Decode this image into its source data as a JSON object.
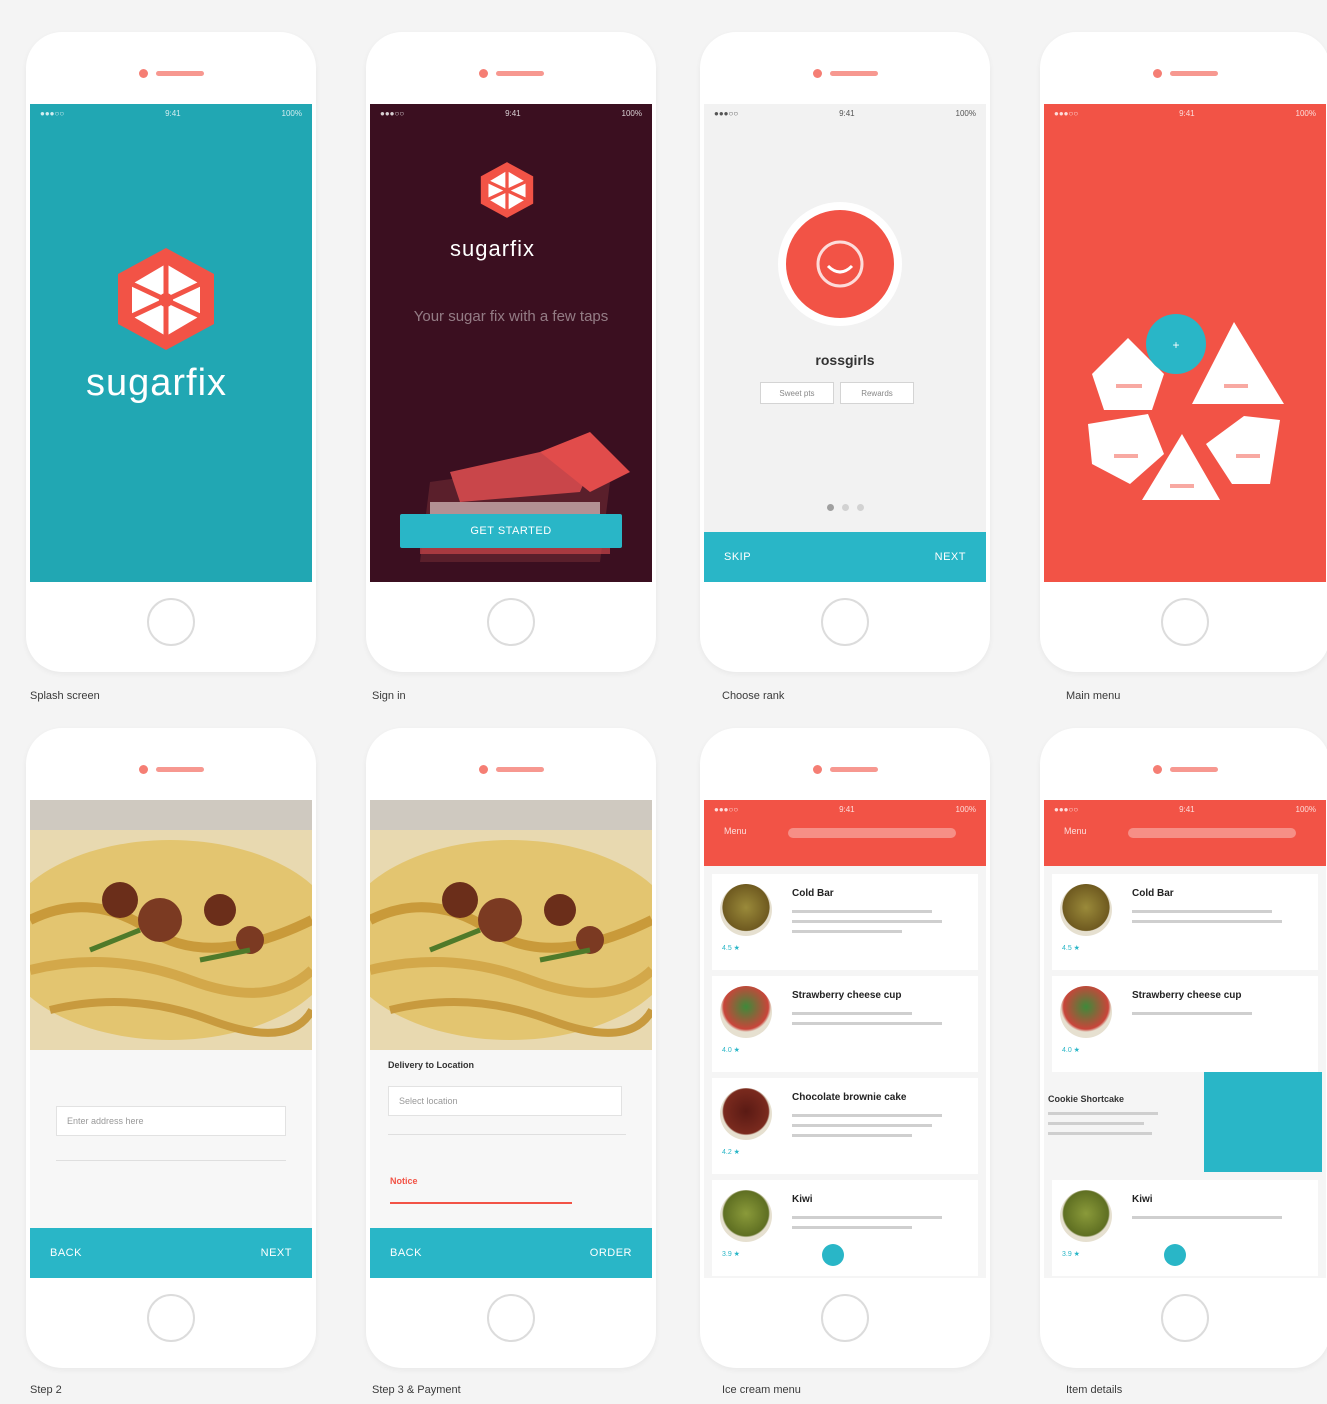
{
  "colors": {
    "background": "#f4f4f4",
    "teal": "#21a7b3",
    "accent_blue": "#29b6c7",
    "red": "#f25346",
    "maroon": "#3b0f20",
    "white": "#ffffff"
  },
  "screens": [
    {
      "label": "Splash screen",
      "wordmark": "sugarfix"
    },
    {
      "label": "Sign in",
      "wordmark": "sugarfix",
      "tagline": "Your sugar fix with a few taps",
      "cta": "GET STARTED"
    },
    {
      "label": "Choose rank",
      "user_name": "rossgirls",
      "stat_a": "Sweet pts",
      "stat_b": "Rewards",
      "cta_left": "SKIP",
      "cta_right": "NEXT"
    },
    {
      "label": "Main menu"
    },
    {
      "label": "Step 2",
      "field": "Enter address here",
      "cta_left": "BACK",
      "cta_right": "NEXT"
    },
    {
      "label": "Step 3 & Payment",
      "field_title": "Delivery to Location",
      "field_value": "Select location",
      "warning": "Notice",
      "cta_left": "BACK",
      "cta_right": "ORDER"
    },
    {
      "label": "Ice cream menu",
      "header_title": "Menu",
      "items": [
        {
          "name": "Cold Bar",
          "meta": "4.5 ★"
        },
        {
          "name": "Strawberry cheese cup",
          "meta": "4.0 ★"
        },
        {
          "name": "Chocolate brownie cake",
          "meta": "4.2 ★"
        },
        {
          "name": "Kiwi",
          "meta": "3.9 ★"
        }
      ]
    },
    {
      "label": "Item details",
      "header_title": "Menu",
      "items": [
        {
          "name": "Cold Bar",
          "meta": "4.5 ★"
        },
        {
          "name": "Strawberry cheese cup",
          "meta": "4.0 ★"
        },
        {
          "name": "Kiwi",
          "meta": "3.9 ★"
        }
      ],
      "detail_title": "Cookie Shortcake"
    }
  ]
}
